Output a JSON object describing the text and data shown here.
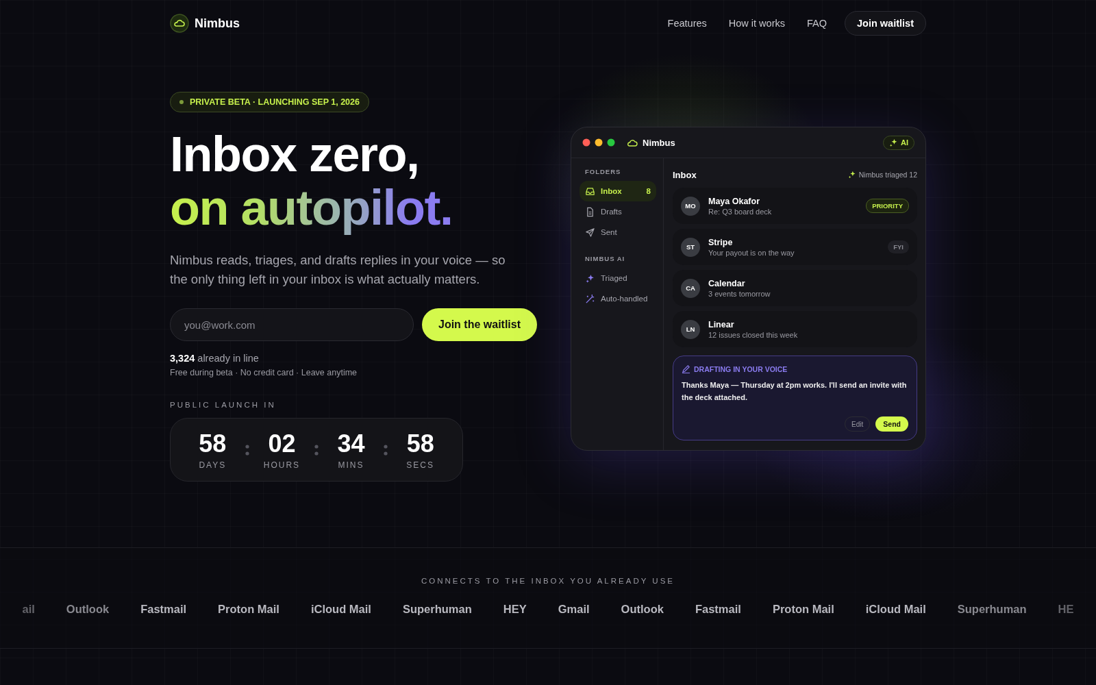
{
  "nav": {
    "brand": "Nimbus",
    "links": [
      "Features",
      "How it works",
      "FAQ"
    ],
    "cta": "Join waitlist"
  },
  "hero": {
    "badge": "PRIVATE BETA · LAUNCHING SEP 1, 2026",
    "title_line1": "Inbox zero,",
    "title_line2": "on autopilot.",
    "subtitle": "Nimbus reads, triages, and drafts replies in your voice — so the only thing left in your inbox is what actually matters.",
    "email": {
      "placeholder": "you@work.com"
    },
    "button": "Join the waitlist",
    "count": "3,324",
    "count_text": "already in line",
    "fine_print": "Free during beta · No credit card · Leave anytime",
    "countdown_label": "PUBLIC LAUNCH IN",
    "countdown": [
      {
        "value": "58",
        "label": "DAYS"
      },
      {
        "value": "02",
        "label": "HOURS"
      },
      {
        "value": "34",
        "label": "MINS"
      },
      {
        "value": "58",
        "label": "SECS"
      }
    ]
  },
  "app": {
    "title": "Nimbus",
    "ai_badge": "AI",
    "folders_heading": "FOLDERS",
    "folders": [
      {
        "label": "Inbox",
        "count": "8",
        "selected": true
      },
      {
        "label": "Drafts",
        "selected": false
      },
      {
        "label": "Sent",
        "selected": false
      }
    ],
    "ai_heading": "NIMBUS AI",
    "ai_items": [
      {
        "label": "Triaged",
        "selected": false
      },
      {
        "label": "Auto-handled",
        "selected": false
      }
    ],
    "inbox_title": "Inbox",
    "triaged_note": "Nimbus triaged 12",
    "messages": [
      {
        "initials": "MO",
        "sender": "Maya Okafor",
        "subject": "Re: Q3 board deck",
        "tag": "PRIORITY",
        "kind": "priority"
      },
      {
        "initials": "ST",
        "sender": "Stripe",
        "subject": "Your payout is on the way",
        "tag": "FYI",
        "kind": "fyi"
      },
      {
        "initials": "CA",
        "sender": "Calendar",
        "subject": "3 events tomorrow",
        "kind": "plain"
      },
      {
        "initials": "LN",
        "sender": "Linear",
        "subject": "12 issues closed this week",
        "kind": "plain"
      }
    ],
    "draft": {
      "heading": "DRAFTING IN YOUR VOICE",
      "text": "Thanks Maya — Thursday at 2pm works. I'll send an invite with the deck attached.",
      "edit": "Edit",
      "send": "Send"
    }
  },
  "integrations": {
    "label": "CONNECTS TO THE INBOX YOU ALREADY USE",
    "items": [
      "ail",
      "Outlook",
      "Fastmail",
      "Proton Mail",
      "iCloud Mail",
      "Superhuman",
      "HEY",
      "Gmail",
      "Outlook",
      "Fastmail",
      "Proton Mail",
      "iCloud Mail",
      "Superhuman",
      "HE"
    ]
  }
}
